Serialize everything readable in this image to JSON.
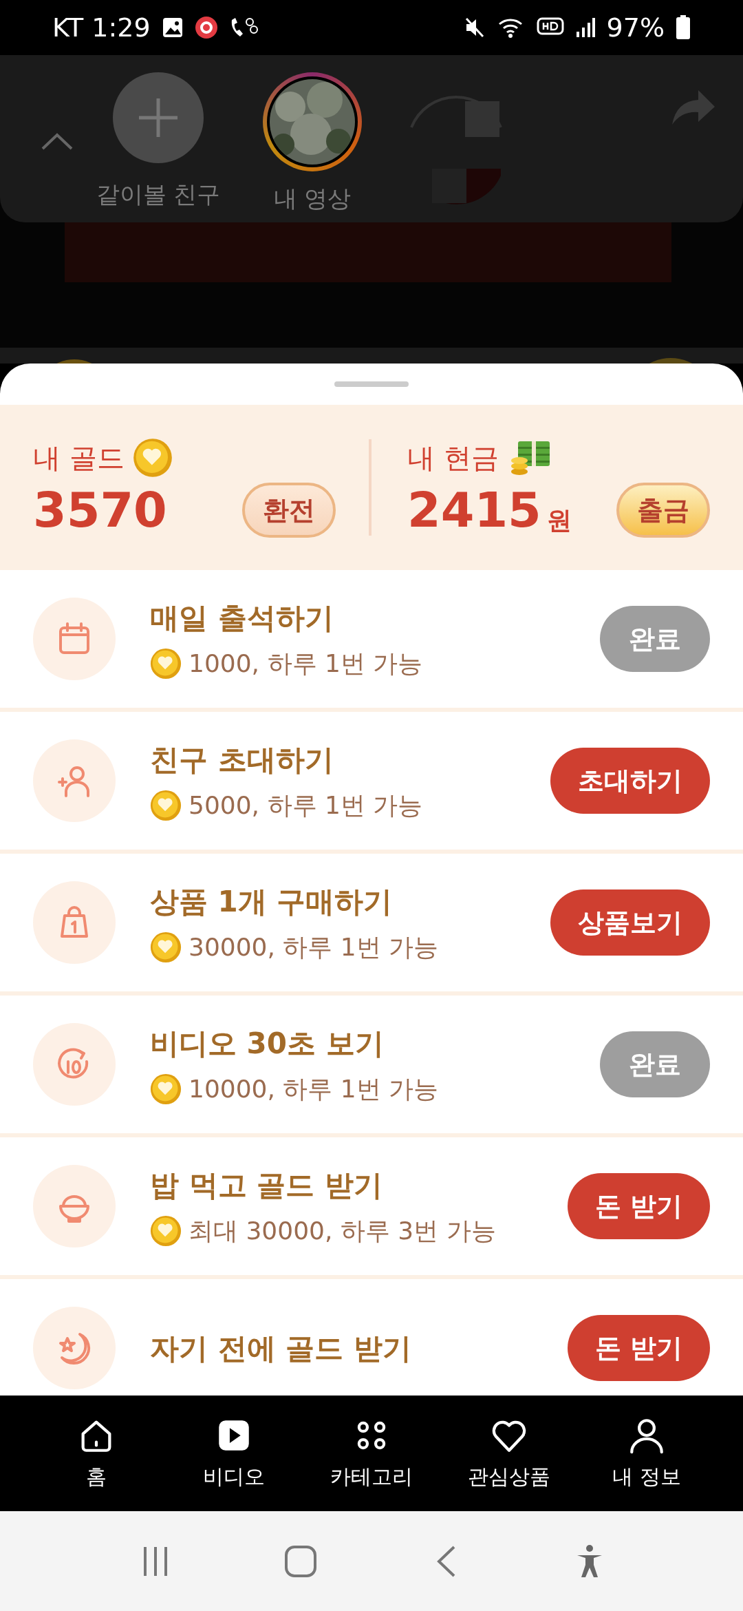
{
  "status_bar": {
    "carrier_time": "KT 1:29",
    "battery": "97%"
  },
  "share_panel": {
    "items": [
      {
        "label": "같이볼 친구"
      },
      {
        "label": "내 영상"
      }
    ]
  },
  "wallet": {
    "gold": {
      "label": "내 골드",
      "amount": "3570",
      "button": "환전"
    },
    "cash": {
      "label": "내 현금",
      "amount": "2415",
      "unit": "원",
      "button": "출금"
    }
  },
  "missions": [
    {
      "title": "매일 출석하기",
      "reward": "1000, 하루 1번 가능",
      "button": "완료",
      "done": true
    },
    {
      "title": "친구 초대하기",
      "reward": "5000, 하루 1번 가능",
      "button": "초대하기",
      "done": false
    },
    {
      "title": "상품 1개 구매하기",
      "reward": "30000, 하루 1번 가능",
      "button": "상품보기",
      "done": false
    },
    {
      "title": "비디오 30초 보기",
      "reward": "10000, 하루 1번 가능",
      "button": "완료",
      "done": true
    },
    {
      "title": "밥 먹고 골드 받기",
      "reward": "최대 30000, 하루 3번 가능",
      "button": "돈 받기",
      "done": false
    },
    {
      "title": "자기 전에 골드 받기",
      "button": "돈 받기",
      "done": false
    }
  ],
  "bottom_nav": [
    {
      "label": "홈"
    },
    {
      "label": "비디오"
    },
    {
      "label": "카테고리"
    },
    {
      "label": "관심상품"
    },
    {
      "label": "내 정보"
    }
  ]
}
